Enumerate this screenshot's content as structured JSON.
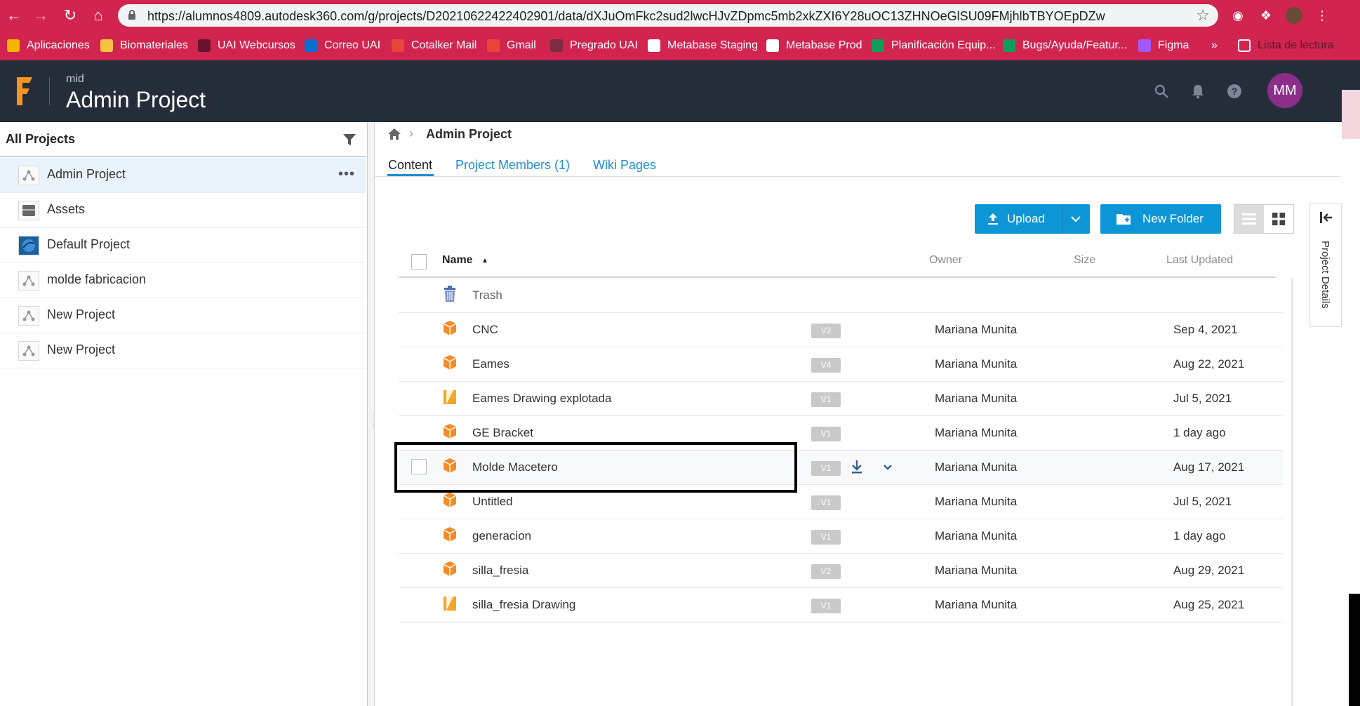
{
  "browser": {
    "url": "https://alumnos4809.autodesk360.com/g/projects/D20210622422402901/data/dXJuOmFkc2sud2lwcHJvZDpmc5mb2xkZXI6Y28uOC13ZHNOeGlSU09FMjhlbTBYOEpDZw",
    "bookmarks": [
      "Aplicaciones",
      "Biomateriales",
      "UAI Webcursos",
      "Correo UAI",
      "Cotalker Mail",
      "Gmail",
      "Pregrado UAI",
      "Metabase Staging",
      "Metabase Prod",
      "Planificación Equip...",
      "Bugs/Ayuda/Featur...",
      "Figma"
    ],
    "more_bookmarks": "»",
    "reading_list": "Lista de lectura",
    "colors": {
      "bar": "#d1244f"
    }
  },
  "header": {
    "hub": "mid",
    "title": "Admin Project",
    "avatar_initials": "MM",
    "icons": [
      "search-icon",
      "bell-icon",
      "help-icon"
    ],
    "colors": {
      "bg": "#262d3a",
      "avatar": "#8b2e8a",
      "logo": "#f7941d"
    }
  },
  "sidebar": {
    "filter_label": "All Projects",
    "more": "•••",
    "projects": [
      {
        "label": "Admin Project",
        "icon": "project-icon",
        "active": true
      },
      {
        "label": "Assets",
        "icon": "assets-icon"
      },
      {
        "label": "Default Project",
        "icon": "default-project-icon"
      },
      {
        "label": "molde fabricacion",
        "icon": "project-icon"
      },
      {
        "label": "New Project",
        "icon": "project-icon"
      },
      {
        "label": "New Project",
        "icon": "project-icon"
      }
    ]
  },
  "main": {
    "breadcrumb_current": "Admin Project",
    "tabs": [
      "Content",
      "Project Members (1)",
      "Wiki Pages"
    ],
    "upload_label": "Upload",
    "new_folder_label": "New Folder",
    "project_details_label": "Project Details",
    "accent": "#0c96d6"
  },
  "table": {
    "columns": {
      "name": "Name",
      "owner": "Owner",
      "size": "Size",
      "updated": "Last Updated"
    },
    "trash": "Trash",
    "rows": [
      {
        "name": "CNC",
        "type": "design",
        "version": "V2",
        "owner": "Mariana Munita",
        "updated": "Sep 4, 2021"
      },
      {
        "name": "Eames",
        "type": "design",
        "version": "V4",
        "owner": "Mariana Munita",
        "updated": "Aug 22, 2021"
      },
      {
        "name": "Eames Drawing explotada",
        "type": "drawing",
        "version": "V1",
        "owner": "Mariana Munita",
        "updated": "Jul 5, 2021"
      },
      {
        "name": "GE Bracket",
        "type": "design",
        "version": "V1",
        "owner": "Mariana Munita",
        "updated": "1 day ago"
      },
      {
        "name": "Molde Macetero",
        "type": "design",
        "version": "V1",
        "owner": "Mariana Munita",
        "updated": "Aug 17, 2021",
        "hover": true
      },
      {
        "name": "Untitled",
        "type": "design",
        "version": "V1",
        "owner": "Mariana Munita",
        "updated": "Jul 5, 2021"
      },
      {
        "name": "generacion",
        "type": "design",
        "version": "V1",
        "owner": "Mariana Munita",
        "updated": "1 day ago"
      },
      {
        "name": "silla_fresia",
        "type": "design",
        "version": "V2",
        "owner": "Mariana Munita",
        "updated": "Aug 29, 2021"
      },
      {
        "name": "silla_fresia Drawing",
        "type": "drawing",
        "version": "V1",
        "owner": "Mariana Munita",
        "updated": "Aug 25, 2021"
      }
    ]
  }
}
